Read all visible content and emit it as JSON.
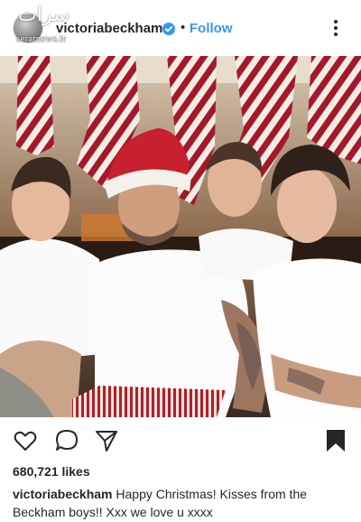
{
  "post": {
    "username": "victoriabeckham",
    "separator": "•",
    "follow_label": "Follow",
    "likes": "680,721 likes",
    "caption_user": "victoriabeckham",
    "caption_text": "Happy Christmas! Kisses from the Beckham boys!! Xxx we love u xxxx"
  },
  "watermark": {
    "site": "seratnews.ir"
  },
  "icons": {
    "verified": "verified-badge-icon",
    "more": "more-options-icon",
    "like": "heart-icon",
    "comment": "comment-icon",
    "share": "paper-plane-icon",
    "save": "bookmark-icon"
  },
  "colors": {
    "accent": "#3897f0",
    "text": "#262626",
    "stocking_red": "#a3182b",
    "hat_red": "#c8202e"
  }
}
